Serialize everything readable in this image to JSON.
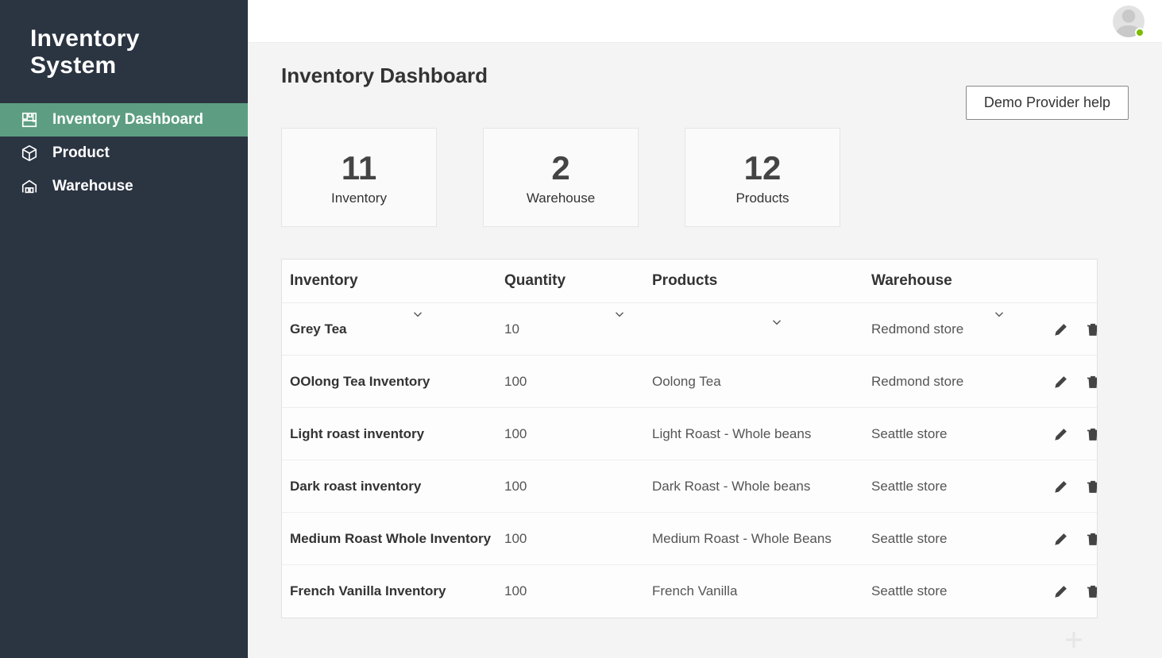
{
  "app": {
    "title": "Inventory System"
  },
  "sidebar": {
    "items": [
      {
        "label": "Inventory Dashboard",
        "active": true,
        "icon": "dashboard-icon"
      },
      {
        "label": "Product",
        "active": false,
        "icon": "package-icon"
      },
      {
        "label": "Warehouse",
        "active": false,
        "icon": "warehouse-icon"
      }
    ]
  },
  "topbar": {
    "help_label": "Demo Provider help"
  },
  "page": {
    "title": "Inventory Dashboard"
  },
  "stats": [
    {
      "value": "11",
      "label": "Inventory"
    },
    {
      "value": "2",
      "label": "Warehouse"
    },
    {
      "value": "12",
      "label": "Products"
    }
  ],
  "table": {
    "columns": {
      "inventory": "Inventory",
      "quantity": "Quantity",
      "products": "Products",
      "warehouse": "Warehouse"
    },
    "rows": [
      {
        "inventory": "Grey Tea",
        "quantity": "10",
        "products": "",
        "warehouse": "Redmond store"
      },
      {
        "inventory": "OOlong Tea Inventory",
        "quantity": "100",
        "products": "Oolong Tea",
        "warehouse": "Redmond store"
      },
      {
        "inventory": "Light roast inventory",
        "quantity": "100",
        "products": "Light Roast - Whole beans",
        "warehouse": "Seattle store"
      },
      {
        "inventory": "Dark roast inventory",
        "quantity": "100",
        "products": "Dark Roast - Whole beans",
        "warehouse": "Seattle store"
      },
      {
        "inventory": "Medium Roast Whole Inventory",
        "quantity": "100",
        "products": "Medium Roast - Whole Beans",
        "warehouse": "Seattle store"
      },
      {
        "inventory": "French Vanilla Inventory",
        "quantity": "100",
        "products": "French Vanilla",
        "warehouse": "Seattle store"
      }
    ]
  }
}
